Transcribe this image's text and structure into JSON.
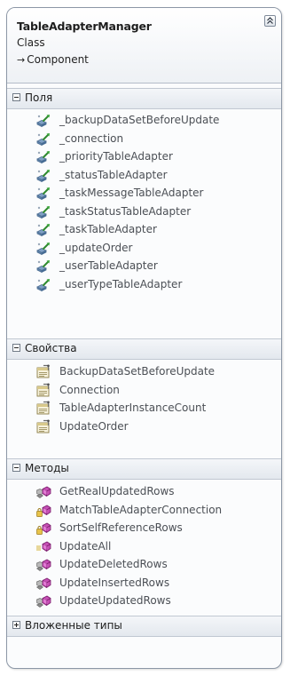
{
  "header": {
    "title": "TableAdapterManager",
    "subtitle": "Class",
    "inherits_arrow": "→",
    "inherits": "Component"
  },
  "sections": [
    {
      "title": "Поля",
      "expanded": true,
      "icon": "field-icon",
      "items": [
        "_backupDataSetBeforeUpdate",
        "_connection",
        "_priorityTableAdapter",
        "_statusTableAdapter",
        "_taskMessageTableAdapter",
        "_taskStatusTableAdapter",
        "_taskTableAdapter",
        "_updateOrder",
        "_userTableAdapter",
        "_userTypeTableAdapter"
      ]
    },
    {
      "title": "Свойства",
      "expanded": true,
      "icon": "property-icon",
      "items": [
        "BackupDataSetBeforeUpdate",
        "Connection",
        "TableAdapterInstanceCount",
        "UpdateOrder"
      ]
    },
    {
      "title": "Методы",
      "expanded": true,
      "icons": [
        "protected-method-icon",
        "private-method-icon",
        "private-method-icon",
        "public-method-icon",
        "protected-method-icon",
        "protected-method-icon",
        "protected-method-icon"
      ],
      "items": [
        "GetRealUpdatedRows",
        "MatchTableAdapterConnection",
        "SortSelfReferenceRows",
        "UpdateAll",
        "UpdateDeletedRows",
        "UpdateInsertedRows",
        "UpdateUpdatedRows"
      ]
    },
    {
      "title": "Вложенные типы",
      "expanded": false,
      "items": []
    }
  ]
}
